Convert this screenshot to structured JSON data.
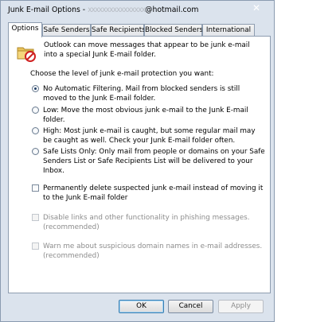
{
  "window": {
    "title": "Junk E-mail Options - ",
    "email_blur": "xxxxxxxxxxxxxxxx",
    "email_domain": "@hotmail.com",
    "close_glyph": "✕"
  },
  "tabs": [
    {
      "label": "Options",
      "active": true
    },
    {
      "label": "Safe Senders",
      "active": false
    },
    {
      "label": "Safe Recipients",
      "active": false
    },
    {
      "label": "Blocked Senders",
      "active": false
    },
    {
      "label": "International",
      "active": false
    }
  ],
  "options": {
    "intro": "Outlook can move messages that appear to be junk e-mail into a special Junk E-mail folder.",
    "heading": "Choose the level of junk e-mail protection you want:",
    "levels": [
      {
        "label": "No Automatic Filtering. Mail from blocked senders is still moved to the Junk E-mail folder.",
        "selected": true
      },
      {
        "label": "Low: Move the most obvious junk e-mail to the Junk E-mail folder.",
        "selected": false
      },
      {
        "label": "High: Most junk e-mail is caught, but some regular mail may be caught as well. Check your Junk E-mail folder often.",
        "selected": false
      },
      {
        "label": "Safe Lists Only: Only mail from people or domains on your Safe Senders List or Safe Recipients List will be delivered to your Inbox.",
        "selected": false
      }
    ],
    "permanently_delete": {
      "label": "Permanently delete suspected junk e-mail instead of moving it to the Junk E-mail folder",
      "checked": false,
      "enabled": true
    },
    "disable_links": {
      "label": "Disable links and other functionality in phishing messages. (recommended)",
      "checked": false,
      "enabled": false
    },
    "warn_domains": {
      "label": "Warn me about suspicious domain names in e-mail addresses. (recommended)",
      "checked": false,
      "enabled": false
    }
  },
  "buttons": {
    "ok": "OK",
    "cancel": "Cancel",
    "apply": "Apply"
  },
  "colors": {
    "frame": "#dbe3ed",
    "panel": "#ffffff",
    "default_button_border": "#3c7fb1"
  }
}
